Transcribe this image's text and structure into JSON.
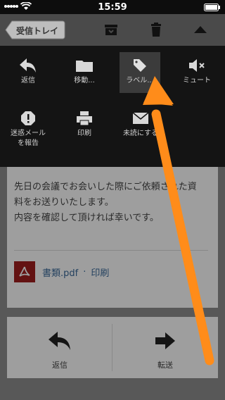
{
  "status_bar": {
    "time": "15:59"
  },
  "navbar": {
    "back_label": "受信トレイ"
  },
  "overlay_menu": {
    "row1": [
      {
        "label": "返信",
        "icon": "reply-icon"
      },
      {
        "label": "移動...",
        "icon": "folder-icon"
      },
      {
        "label": "ラベル...",
        "icon": "tag-icon",
        "active": true
      },
      {
        "label": "ミュート",
        "icon": "mute-icon"
      }
    ],
    "row2": [
      {
        "label": "迷惑メール\nを報告",
        "icon": "spam-icon"
      },
      {
        "label": "印刷",
        "icon": "printer-icon"
      },
      {
        "label": "未読にする",
        "icon": "mark-unread-icon"
      }
    ]
  },
  "message": {
    "body_lines": [
      "先日の会議でお会いした際にご依頼された資",
      "料をお送りいたします。",
      "内容を確認して頂ければ幸いです。"
    ],
    "attachment_name": "書類.pdf",
    "attachment_separator": "·",
    "attachment_print": "印刷"
  },
  "actions": {
    "reply_label": "返信",
    "forward_label": "転送"
  },
  "colors": {
    "accent_arrow": "#ff8c1a",
    "link": "#3a6a9a",
    "pdf": "#a11e1e"
  }
}
